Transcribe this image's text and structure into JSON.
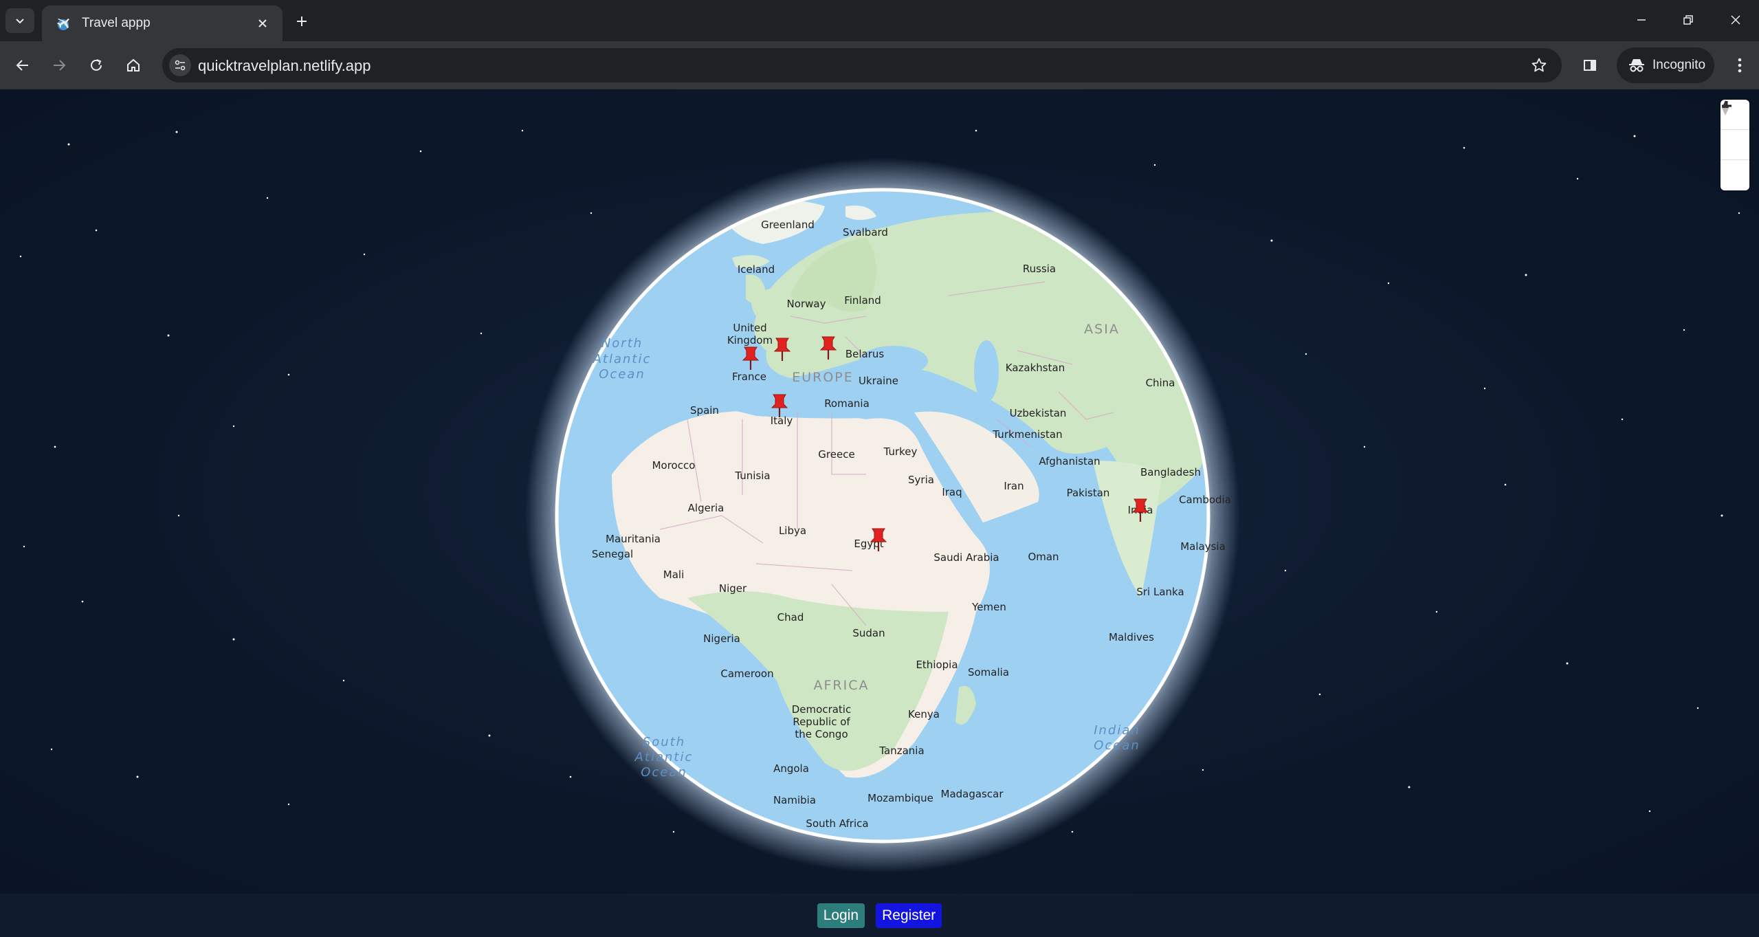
{
  "browser": {
    "tab_title": "Travel appp",
    "url": "quicktravelplan.netlify.app",
    "incognito_label": "Incognito"
  },
  "map": {
    "zoom_in_label": "+",
    "zoom_out_label": "−",
    "labels": {
      "greenland": "Greenland",
      "svalbard": "Svalbard",
      "iceland": "Iceland",
      "russia": "Russia",
      "norway": "Norway",
      "finland": "Finland",
      "uk_line1": "United",
      "uk_line2": "Kingdom",
      "asia": "ASIA",
      "belarus": "Belarus",
      "kazakhstan": "Kazakhstan",
      "france": "France",
      "europe": "EUROPE",
      "ukraine": "Ukraine",
      "china": "China",
      "spain": "Spain",
      "romania": "Romania",
      "uzbekistan": "Uzbekistan",
      "italy": "Italy",
      "turkmenistan": "Turkmenistan",
      "greece": "Greece",
      "turkey": "Turkey",
      "afghanistan": "Afghanistan",
      "morocco": "Morocco",
      "tunisia": "Tunisia",
      "syria": "Syria",
      "bangladesh": "Bangladesh",
      "iraq": "Iraq",
      "iran": "Iran",
      "pakistan": "Pakistan",
      "cambodia": "Cambodia",
      "algeria": "Algeria",
      "india": "India",
      "libya": "Libya",
      "mauritania": "Mauritania",
      "egypt": "Egypt",
      "malaysia": "Malaysia",
      "senegal": "Senegal",
      "saudi_arabia": "Saudi Arabia",
      "oman": "Oman",
      "mali": "Mali",
      "niger": "Niger",
      "sri_lanka": "Sri Lanka",
      "yemen": "Yemen",
      "chad": "Chad",
      "sudan": "Sudan",
      "maldives": "Maldives",
      "nigeria": "Nigeria",
      "ethiopia": "Ethiopia",
      "cameroon": "Cameroon",
      "somalia": "Somalia",
      "africa": "AFRICA",
      "drc_line1": "Democratic",
      "drc_line2": "Republic of",
      "drc_line3": "the Congo",
      "kenya": "Kenya",
      "tanzania": "Tanzania",
      "angola": "Angola",
      "mozambique": "Mozambique",
      "madagascar": "Madagascar",
      "namibia": "Namibia",
      "south_africa": "South Africa",
      "north_atlantic_1": "North",
      "north_atlantic_2": "Atlantic",
      "north_atlantic_3": "Ocean",
      "south_atlantic_1": "South",
      "south_atlantic_2": "Atlantic",
      "south_atlantic_3": "Ocean",
      "indian_ocean_1": "Indian",
      "indian_ocean_2": "Ocean"
    },
    "pin_color": "#e0231f"
  },
  "footer": {
    "login_label": "Login",
    "register_label": "Register"
  }
}
